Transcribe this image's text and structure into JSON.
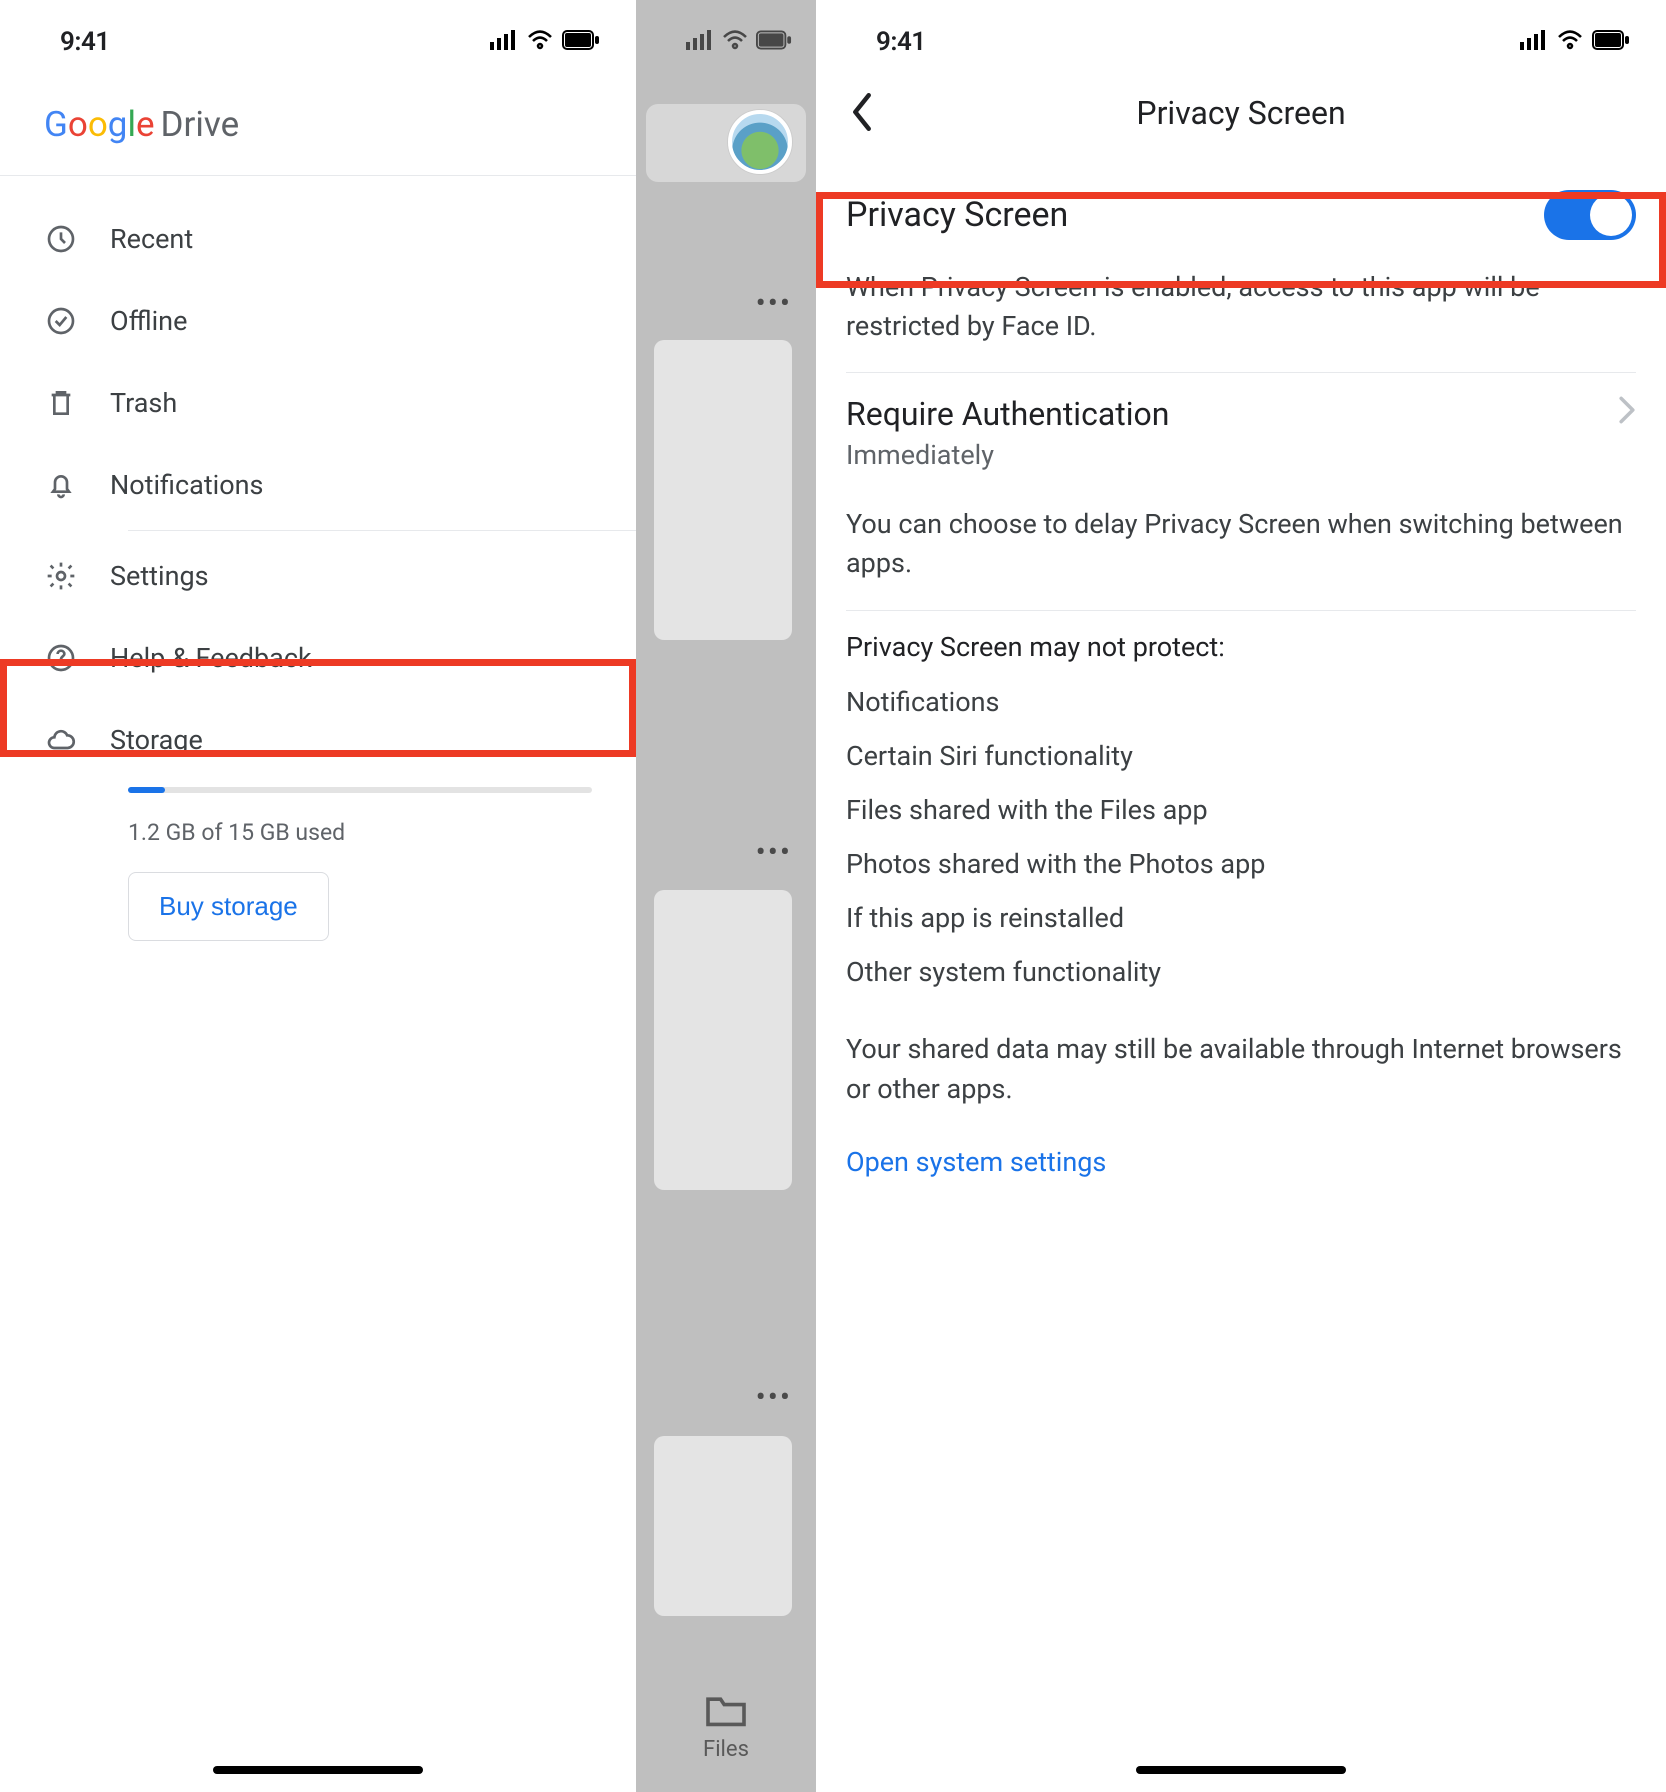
{
  "status": {
    "time": "9:41"
  },
  "drive_logo": {
    "google": "Google",
    "suffix": "Drive"
  },
  "sidebar": {
    "items": [
      {
        "label": "Recent"
      },
      {
        "label": "Offline"
      },
      {
        "label": "Trash"
      },
      {
        "label": "Notifications"
      },
      {
        "label": "Settings"
      },
      {
        "label": "Help & Feedback"
      },
      {
        "label": "Storage"
      }
    ],
    "storage_used": "1.2 GB of 15 GB used",
    "buy_label": "Buy storage"
  },
  "mid": {
    "tab_label": "Files"
  },
  "privacy": {
    "page_title": "Privacy Screen",
    "toggle_label": "Privacy Screen",
    "toggle_on": true,
    "toggle_desc": "When Privacy Screen is enabled, access to this app will be restricted by Face ID.",
    "auth_label": "Require Authentication",
    "auth_value": "Immediately",
    "auth_desc": "You can choose to delay Privacy Screen when switching between apps.",
    "not_protect_header": "Privacy Screen may not protect:",
    "not_protect_items": [
      "Notifications",
      "Certain Siri functionality",
      "Files shared with the Files app",
      "Photos shared with the Photos app",
      "If this app is reinstalled",
      "Other system functionality"
    ],
    "shared_para": "Your shared data may still be available through Internet browsers or other apps.",
    "open_settings": "Open system settings"
  }
}
